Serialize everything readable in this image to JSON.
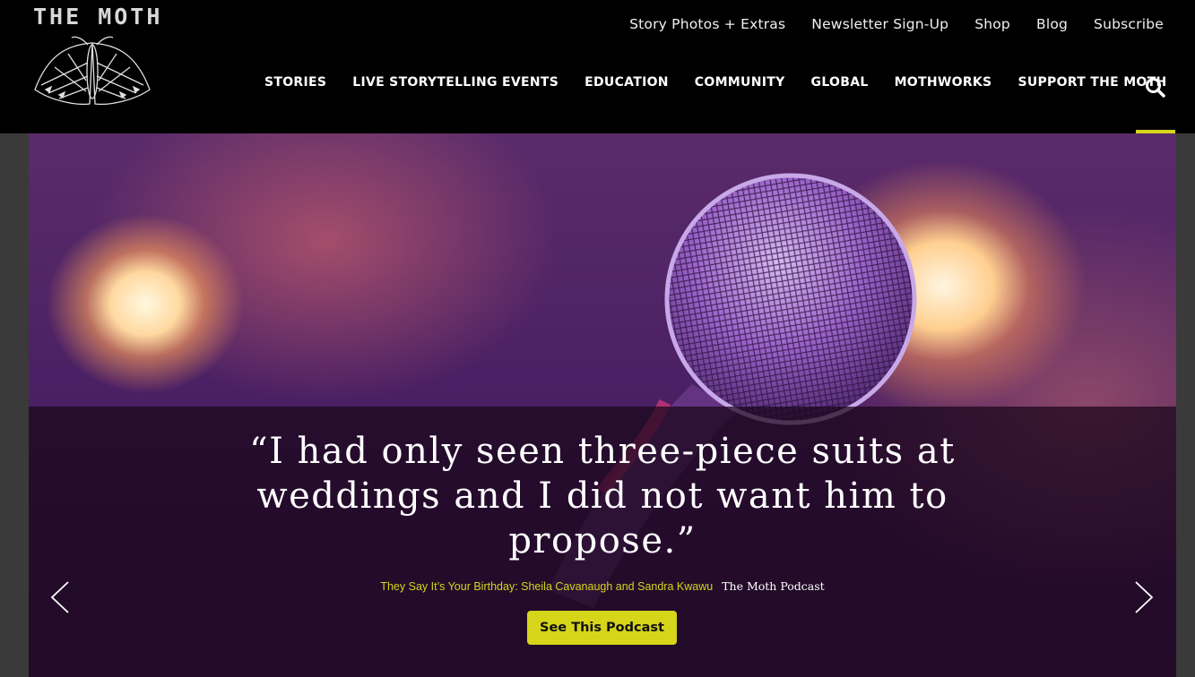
{
  "header": {
    "logo_text": "THE MOTH",
    "utility_nav": [
      "Story Photos + Extras",
      "Newsletter Sign-Up",
      "Shop",
      "Blog",
      "Subscribe"
    ],
    "main_nav": [
      "STORIES",
      "LIVE STORYTELLING EVENTS",
      "EDUCATION",
      "COMMUNITY",
      "GLOBAL",
      "MOTHWORKS",
      "SUPPORT THE MOTH"
    ],
    "search_icon": "search-icon"
  },
  "hero": {
    "quote": "“I had only seen three-piece suits at weddings and I did not want him to propose.”",
    "story_title": "They Say It’s Your Birthday: Sheila Cavanaugh and Sandra Kwawu",
    "source": "The Moth Podcast",
    "cta_label": "See This Podcast",
    "prev_icon": "chevron-left-icon",
    "next_icon": "chevron-right-icon"
  },
  "colors": {
    "accent": "#d6d51a",
    "header_bg": "#000000",
    "page_bg": "#3a3a3a"
  }
}
